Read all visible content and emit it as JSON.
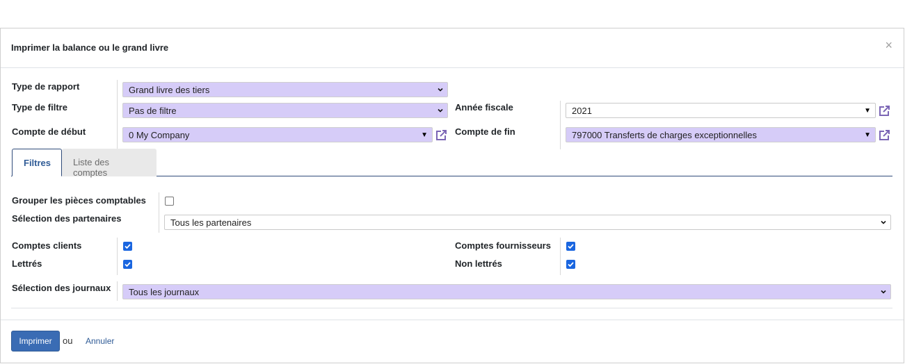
{
  "dialog": {
    "title": "Imprimer la balance ou le grand livre",
    "close_symbol": "×"
  },
  "fields": {
    "type_rapport": {
      "label": "Type de rapport",
      "value": "Grand livre des tiers"
    },
    "type_filtre": {
      "label": "Type de filtre",
      "value": "Pas de filtre"
    },
    "annee_fiscale": {
      "label": "Année fiscale",
      "value": "2021"
    },
    "compte_debut": {
      "label": "Compte de début",
      "value": "0 My Company"
    },
    "compte_fin": {
      "label": "Compte de fin",
      "value": "797000 Transferts de charges exceptionnelles"
    }
  },
  "tabs": [
    {
      "label": "Filtres",
      "active": true
    },
    {
      "label": "Liste des comptes",
      "active": false
    }
  ],
  "filters": {
    "grouper_pieces": {
      "label": "Grouper les pièces comptables",
      "checked": false
    },
    "selection_partenaires": {
      "label": "Sélection des partenaires",
      "value": "Tous les partenaires"
    },
    "comptes_clients": {
      "label": "Comptes clients",
      "checked": true
    },
    "comptes_fournisseurs": {
      "label": "Comptes fournisseurs",
      "checked": true
    },
    "lettres": {
      "label": "Lettrés",
      "checked": true
    },
    "non_lettres": {
      "label": "Non lettrés",
      "checked": true
    },
    "selection_journaux": {
      "label": "Sélection des journaux",
      "value": "Tous les journaux"
    }
  },
  "footer": {
    "print_label": "Imprimer",
    "or_label": "ou",
    "cancel_label": "Annuler"
  },
  "colors": {
    "select_fill": "#d6ccf8",
    "primary": "#3a6cb4",
    "checkbox": "#1a66e0",
    "link": "#2f5b96",
    "ext_link_icon": "#7b65b5"
  },
  "icons": {
    "close": "close-icon",
    "dropdown": "chevron-down-icon",
    "external": "external-link-icon",
    "checkbox_on": "checkbox-checked-icon"
  }
}
